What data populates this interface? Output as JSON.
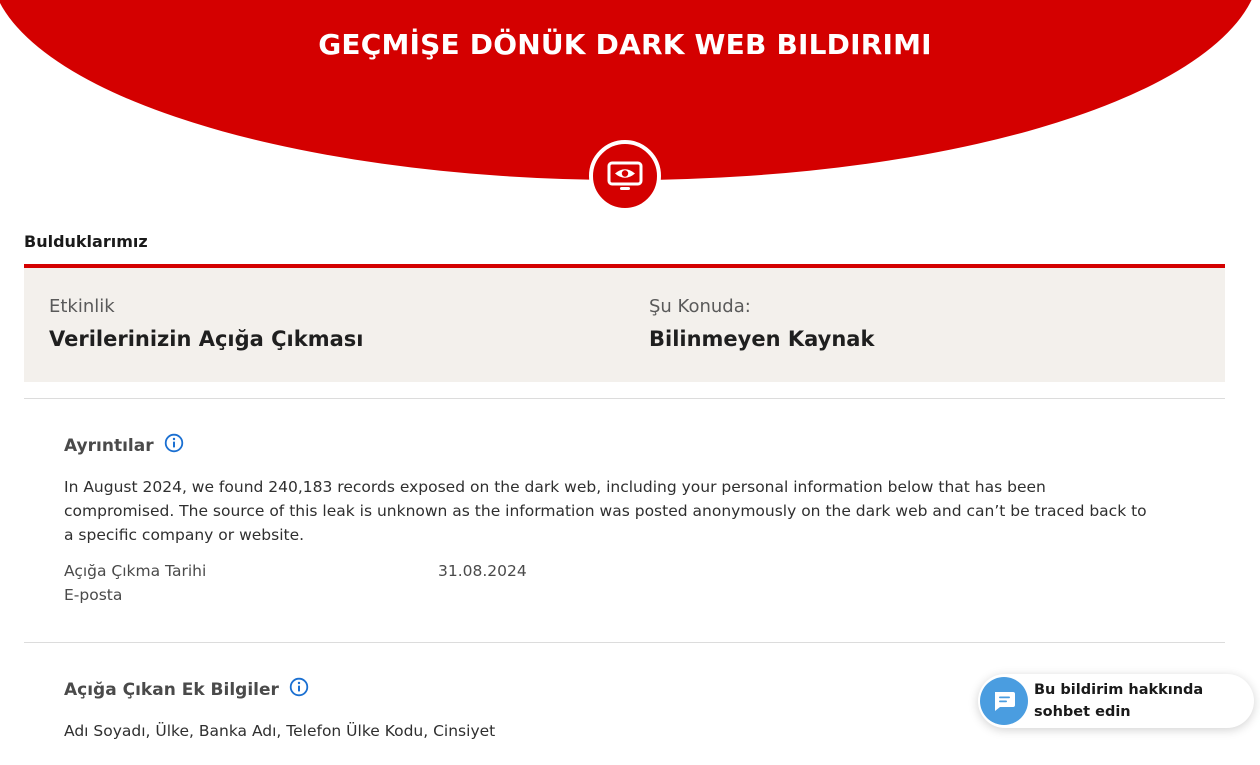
{
  "header": {
    "title": "GEÇMİŞE DÖNÜK DARK WEB BILDIRIMI",
    "badge_icon": "monitor-eye-icon"
  },
  "findings": {
    "section_label": "Bulduklarımız",
    "event_label": "Etkinlik",
    "event_value": "Verilerinizin Açığa Çıkması",
    "source_label": "Şu Konuda:",
    "source_value": "Bilinmeyen Kaynak"
  },
  "details": {
    "heading": "Ayrıntılar",
    "description": "In August 2024, we found 240,183 records exposed on the dark web, including your personal information below that has been compromised. The source of this leak is unknown as the information was posted anonymously on the dark web and can’t be traced back to a specific company or website.",
    "date_label": "Açığa Çıkma Tarihi",
    "date_value": "31.08.2024",
    "email_label": "E-posta"
  },
  "additional": {
    "heading": "Açığa Çıkan Ek Bilgiler",
    "items": "Adı Soyadı, Ülke, Banka Adı, Telefon Ülke Kodu, Cinsiyet"
  },
  "chat": {
    "label": "Bu bildirim hakkında sohbet edin"
  },
  "colors": {
    "brand_red": "#d40000",
    "panel_bg": "#f3f0ec",
    "info_blue": "#1a6fd1",
    "chat_blue": "#4a9de0"
  }
}
